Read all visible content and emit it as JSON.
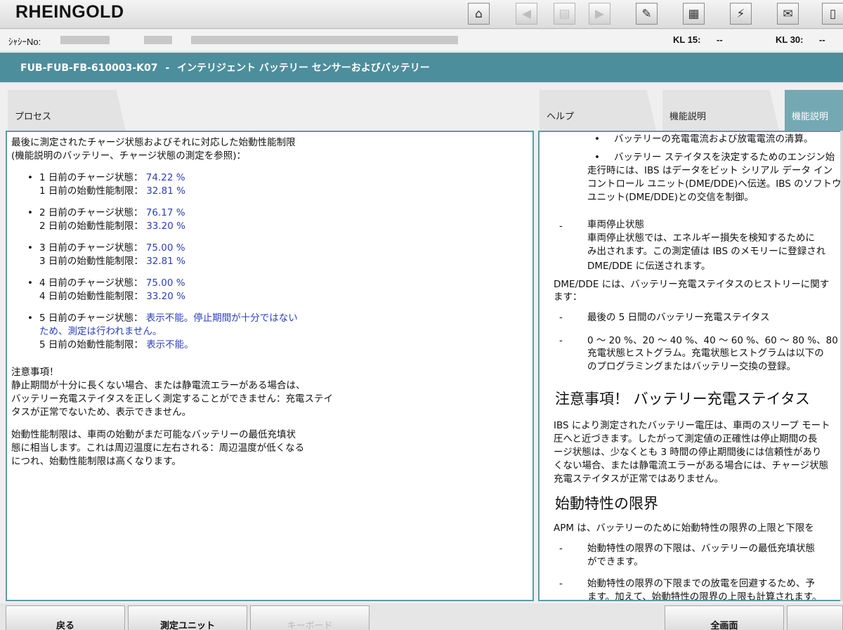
{
  "app": {
    "title": "RHEINGOLD"
  },
  "toolbar": {
    "buttons": [
      {
        "icon": "home-icon",
        "glyph": "⌂"
      },
      {
        "icon": "back-arrow-icon",
        "glyph": "◀"
      },
      {
        "icon": "clipboard-icon",
        "glyph": "▤"
      },
      {
        "icon": "forward-arrow-icon",
        "glyph": "▶"
      },
      {
        "icon": "wrench-icon",
        "glyph": "✎"
      },
      {
        "icon": "diagnosis-icon",
        "glyph": "▦"
      },
      {
        "icon": "plug-icon",
        "glyph": "⚡"
      },
      {
        "icon": "mail-icon",
        "glyph": "✉"
      },
      {
        "icon": "battery-icon",
        "glyph": "▯"
      }
    ]
  },
  "info": {
    "chassis_label": "ｼｬｼｰNo:",
    "kl15_label": "KL 15:",
    "kl15_value": "--",
    "kl30_label": "KL 30:",
    "kl30_value": "--"
  },
  "title_bar": {
    "code": "FUB-FUB-FB-610003-K07",
    "separator": "-",
    "text": "インテリジェント バッテリー センサーおよびバッテリー"
  },
  "tabs": {
    "process": "プロセス",
    "help": "ヘルプ",
    "func_desc_1": "機能説明",
    "func_desc_2": "機能説明"
  },
  "left_panel": {
    "intro_1": "最後に測定されたチャージ状態およびそれに対応した始動性能制限",
    "intro_2": "(機能説明のバッテリー、チャージ状態の測定を参照)：",
    "days": [
      {
        "charge_label": "1 日前のチャージ状態：",
        "charge_value": "74.22 %",
        "limit_label": "1 日前の始動性能制限：",
        "limit_value": "32.81 %"
      },
      {
        "charge_label": "2 日前のチャージ状態：",
        "charge_value": "76.17 %",
        "limit_label": "2 日前の始動性能制限：",
        "limit_value": "33.20 %"
      },
      {
        "charge_label": "3 日前のチャージ状態：",
        "charge_value": "75.00 %",
        "limit_label": "3 日前の始動性能制限：",
        "limit_value": "32.81 %"
      },
      {
        "charge_label": "4 日前のチャージ状態：",
        "charge_value": "75.00 %",
        "limit_label": "4 日前の始動性能制限：",
        "limit_value": "33.20 %"
      }
    ],
    "day5": {
      "charge_label": "5 日前のチャージ状態：",
      "charge_value_1": "表示不能。停止期間が十分ではない",
      "charge_value_2": "ため、測定は行われません。",
      "limit_label": "5 日前の始動性能制限：",
      "limit_value": "表示不能。"
    },
    "note_title": "注意事項！",
    "note_1": "静止期間が十分に長くない場合、または静電流エラーがある場合は、",
    "note_2": "バッテリー充電ステイタスを正しく測定することができません：充電ステイ",
    "note_3": "タスが正常でないため、表示できません。",
    "para_1": "始動性能制限は、車両の始動がまだ可能なバッテリーの最低充填状",
    "para_2": "態に相当します。これは周辺温度に左右される：周辺温度が低くなる",
    "para_3": "につれ、始動性能制限は高くなります。"
  },
  "right_panel": {
    "b1": "バッテリーの充電電流および放電電流の清算。",
    "b2": "バッテリー ステイタスを決定するためのエンジン始",
    "b2_l2": "走行時には、IBS はデータをビット シリアル データ イン",
    "b2_l3": "コントロール ユニット(DME/DDE)へ伝送。IBS のソフトウ",
    "b2_l4": "ユニット(DME/DDE)との交信を制御。",
    "stop_title": "車両停止状態",
    "stop_l1": "車両停止状態では、エネルギー損失を検知するために",
    "stop_l2": "み出されます。この測定値は IBS のメモリーに登録され",
    "stop_l3": "DME/DDE に伝送されます。",
    "hist_l1": "DME/DDE には、バッテリー充電ステイタスのヒストリーに関す",
    "hist_l2": "ます：",
    "hist_item1": "最後の 5 日間のバッテリー充電ステイタス",
    "hist_item2_l1": "0 ～ 20 %、20 ～ 40 %、40 ～ 60 %、60 ～ 80 %、80",
    "hist_item2_l2": "充電状態ヒストグラム。充電状態ヒストグラムは以下の",
    "hist_item2_l3": "のプログラミングまたはバッテリー交換の登録。",
    "heading_note": "注意事項！ バッテリー充電ステイタス",
    "note_l1": "IBS により測定されたバッテリー電圧は、車両のスリープ モート",
    "note_l2": "圧へと近づきます。したがって測定値の正確性は停止期間の長",
    "note_l3": "ージ状態は、少なくとも 3 時間の停止期間後には信頼性があり",
    "note_l4": "くない場合、または静電流エラーがある場合には、チャージ状態",
    "note_l5": "充電ステイタスが正常ではありません。",
    "heading_start": "始動特性の限界",
    "apm_l1": "APM は、バッテリーのために始動特性の限界の上限と下限を",
    "lim_item1_l1": "始動特性の限界の下限は、バッテリーの最低充填状態",
    "lim_item1_l2": "ができます。",
    "lim_item2_l1": "始動特性の限界の下限までの放電を回避するため、予",
    "lim_item2_l2": "ます。加えて、始動特性の限界の上限も計算されます。",
    "dash": "-"
  },
  "bottom": {
    "back": "戻る",
    "measure": "測定ユニット",
    "keyboard": "キーボード",
    "fullscreen": "全画面"
  }
}
